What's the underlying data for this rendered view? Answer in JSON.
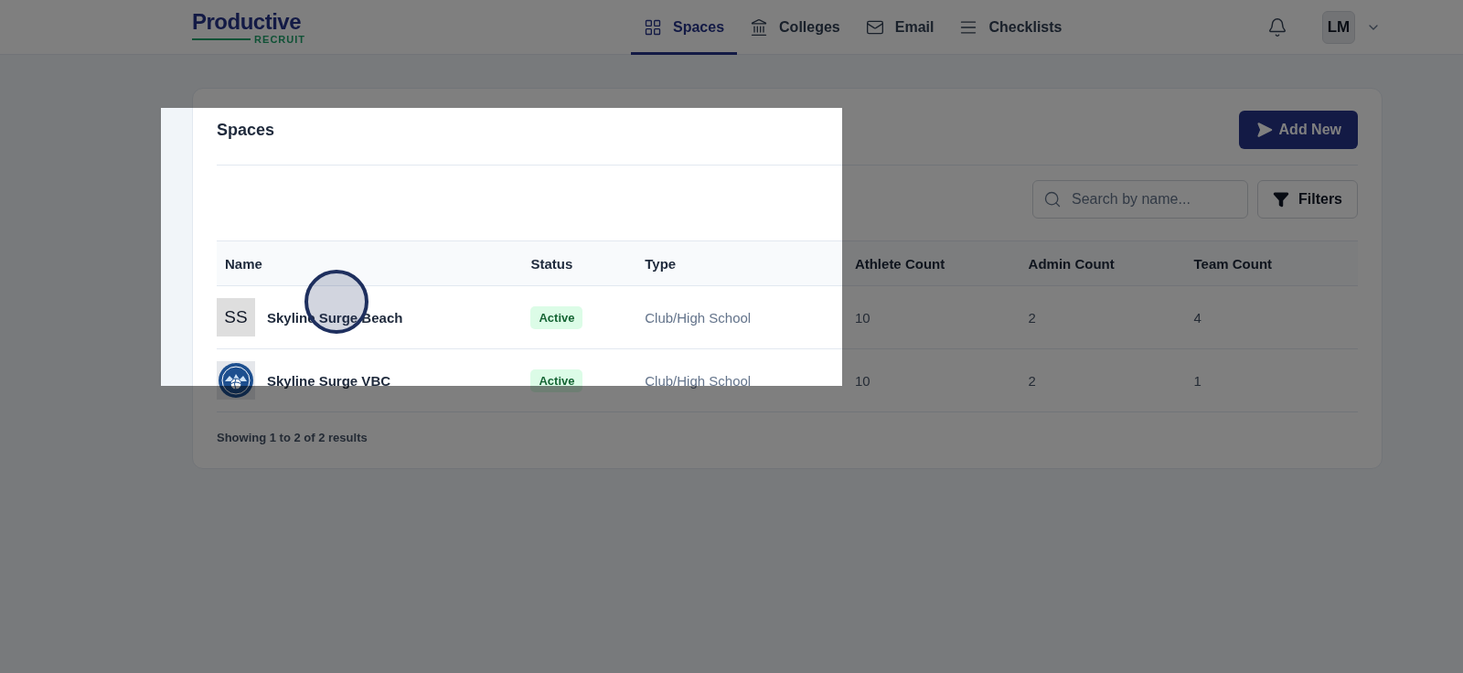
{
  "header": {
    "logo": {
      "name": "Productive",
      "tagline": "RECRUIT"
    },
    "nav": [
      {
        "label": "Spaces",
        "selected": true
      },
      {
        "label": "Colleges",
        "selected": false
      },
      {
        "label": "Email",
        "selected": false
      },
      {
        "label": "Checklists",
        "selected": false
      }
    ],
    "user": {
      "initials": "LM"
    }
  },
  "page": {
    "title": "Spaces",
    "add_button": "Add New",
    "search": {
      "placeholder": "Search by name..."
    },
    "filters_button": "Filters",
    "table": {
      "columns": [
        "Name",
        "Status",
        "Type",
        "Athlete Count",
        "Admin Count",
        "Team Count"
      ],
      "rows": [
        {
          "avatar": {
            "kind": "initials",
            "text": "SS"
          },
          "name": "Skyline Surge Beach",
          "status": "Active",
          "type": "Club/High School",
          "athlete_count": "10",
          "admin_count": "2",
          "team_count": "4"
        },
        {
          "avatar": {
            "kind": "logo"
          },
          "name": "Skyline Surge VBC",
          "status": "Active",
          "type": "Club/High School",
          "athlete_count": "10",
          "admin_count": "2",
          "team_count": "1"
        }
      ]
    },
    "footer": "Showing 1 to 2 of 2 results"
  }
}
